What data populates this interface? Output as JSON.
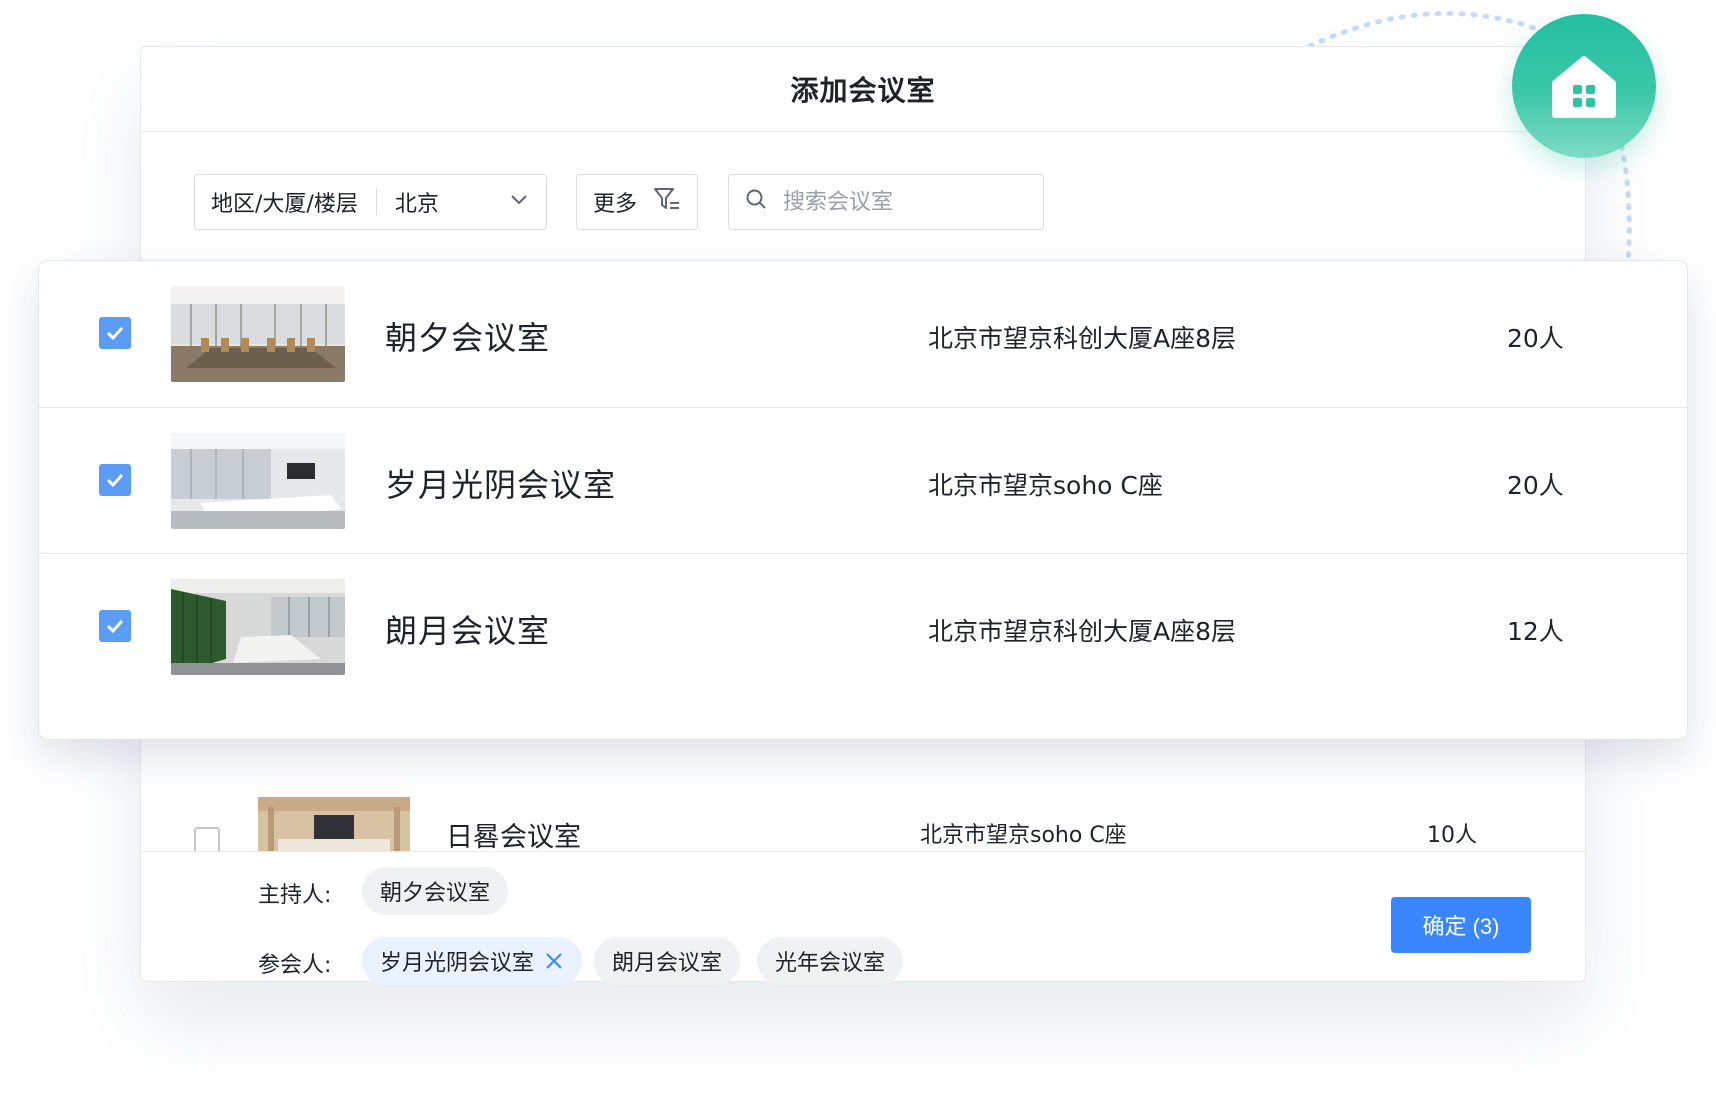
{
  "dialog": {
    "title": "添加会议室"
  },
  "filters": {
    "region_label": "地区/大厦/楼层",
    "region_value": "北京",
    "more_label": "更多",
    "search_placeholder": "搜索会议室"
  },
  "rooms": [
    {
      "name": "朝夕会议室",
      "address": "北京市望京科创大厦A座8层",
      "capacity": "20人",
      "checked": true
    },
    {
      "name": "岁月光阴会议室",
      "address": "北京市望京soho C座",
      "capacity": "20人",
      "checked": true
    },
    {
      "name": "朗月会议室",
      "address": "北京市望京科创大厦A座8层",
      "capacity": "12人",
      "checked": true
    },
    {
      "name": "日晷会议室",
      "address": "北京市望京soho C座",
      "capacity": "10人",
      "checked": false
    }
  ],
  "footer": {
    "host_label": "主持人:",
    "host_chip": "朝夕会议室",
    "attendee_label": "参会人:",
    "attendee_chips": [
      "岁月光阴会议室",
      "朗月会议室",
      "光年会议室"
    ],
    "confirm_label": "确定 (3)"
  },
  "colors": {
    "accent": "#3a86ff",
    "checkbox": "#5b9cf6",
    "badge": "#22bfa0"
  },
  "icons": {
    "badge": "home-icon",
    "region": "chevron-down-icon",
    "more": "filter-icon",
    "search": "search-icon",
    "chip_remove": "close-icon"
  }
}
